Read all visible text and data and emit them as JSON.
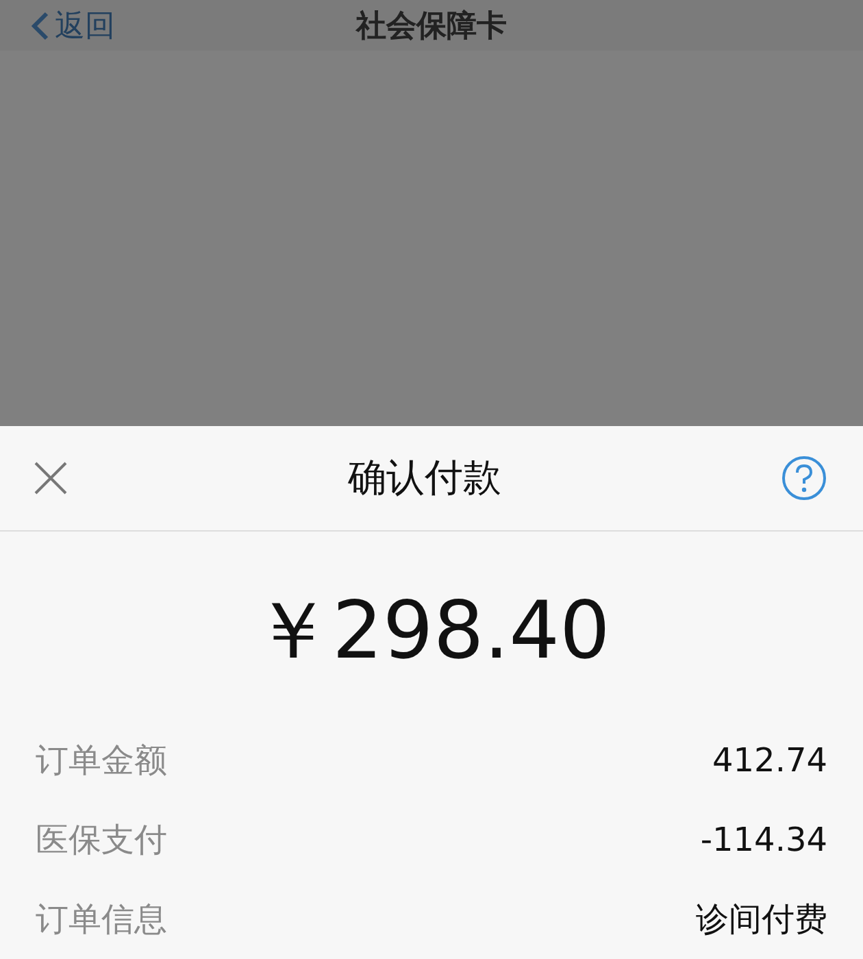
{
  "nav": {
    "back": "返回",
    "title": "社会保障卡"
  },
  "sheet": {
    "title": "确认付款",
    "amount": "￥298.40",
    "rows": [
      {
        "label": "订单金额",
        "value": "412.74"
      },
      {
        "label": "医保支付",
        "value": "-114.34"
      },
      {
        "label": "订单信息",
        "value": "诊间付费"
      }
    ]
  }
}
